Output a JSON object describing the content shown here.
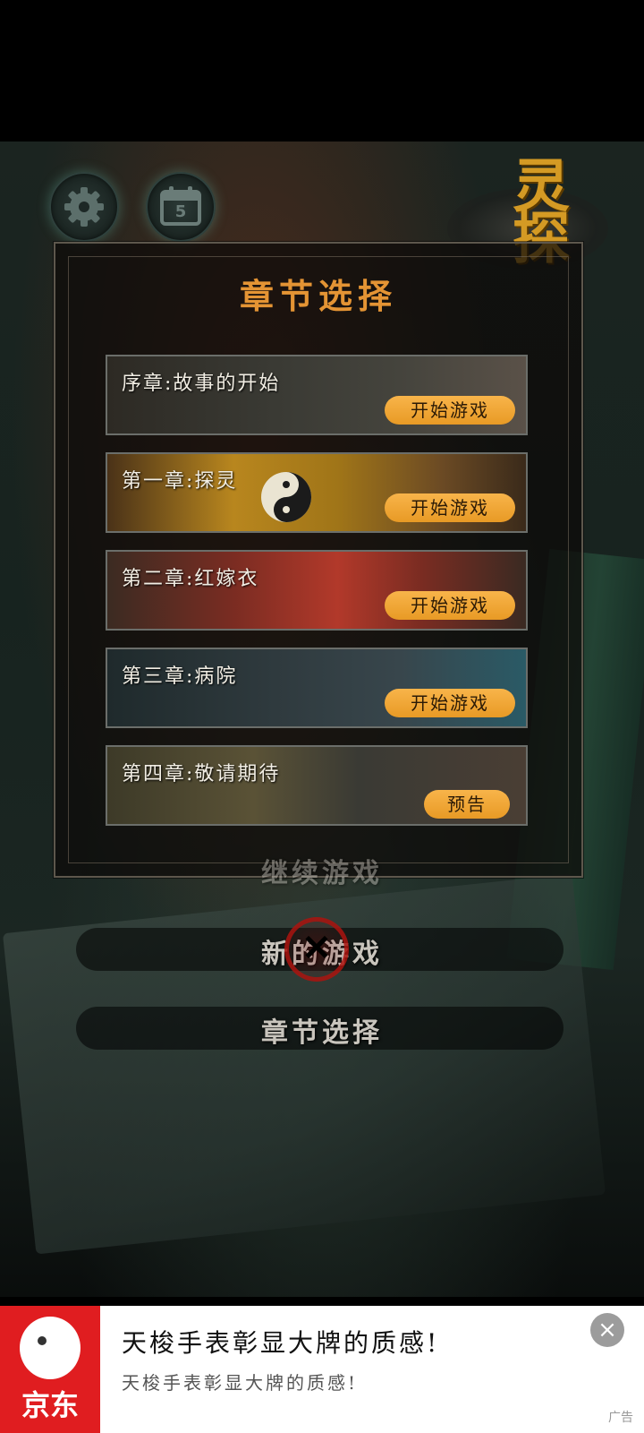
{
  "header": {
    "calendar_day": "5"
  },
  "logo": {
    "text": "灵探"
  },
  "panel": {
    "title": "章节选择",
    "chapters": [
      {
        "name": "序章:故事的开始",
        "button": "开始游戏"
      },
      {
        "name": "第一章:探灵",
        "button": "开始游戏"
      },
      {
        "name": "第二章:红嫁衣",
        "button": "开始游戏"
      },
      {
        "name": "第三章:病院",
        "button": "开始游戏"
      },
      {
        "name": "第四章:敬请期待",
        "button": "预告"
      }
    ]
  },
  "menu": {
    "continue": "继续游戏",
    "new_game": "新的游戏",
    "chapter_select": "章节选择"
  },
  "ad": {
    "brand": "京东",
    "title": "天梭手表彰显大牌的质感!",
    "subtitle": "天梭手表彰显大牌的质感!",
    "label": "广告",
    "close": "×"
  },
  "colors": {
    "accent": "#e49434",
    "button": "#f2a73a",
    "brand_red": "#e01d20"
  }
}
